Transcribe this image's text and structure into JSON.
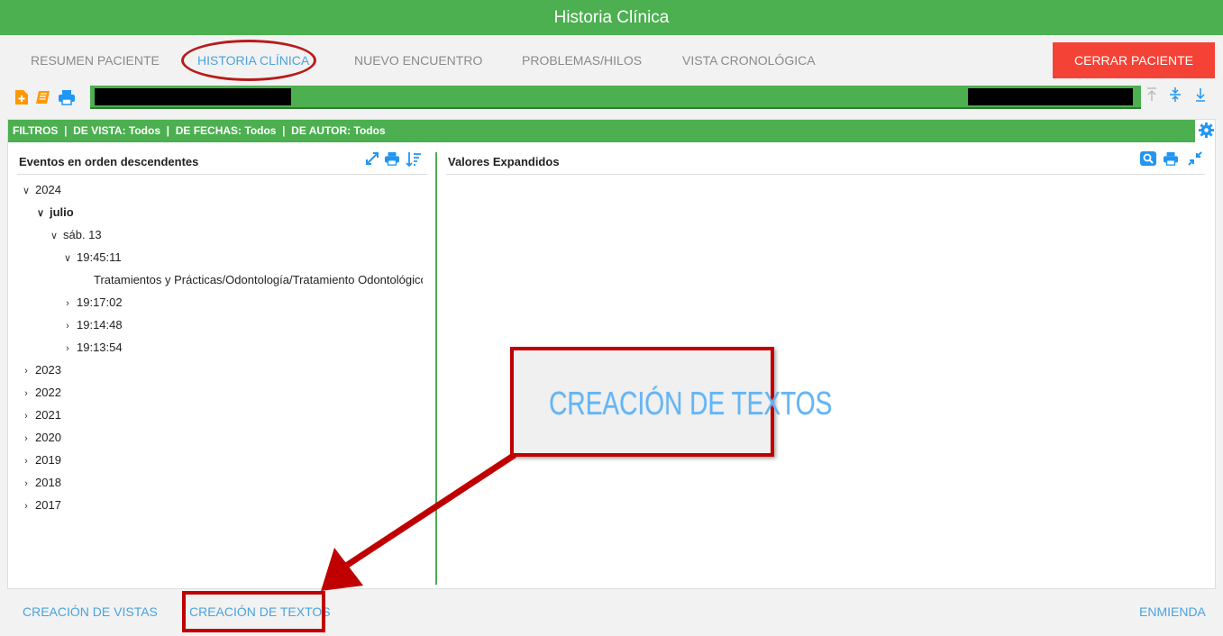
{
  "app": {
    "title": "Historia Clínica"
  },
  "tabs": [
    {
      "label": "RESUMEN PACIENTE"
    },
    {
      "label": "HISTORIA CLÍNICA"
    },
    {
      "label": "NUEVO ENCUENTRO"
    },
    {
      "label": "PROBLEMAS/HILOS"
    },
    {
      "label": "VISTA CRONOLÓGICA"
    }
  ],
  "close_button": {
    "label": "CERRAR PACIENTE",
    "color": "#f44336"
  },
  "toolbar": {
    "icons": [
      "new-document-icon",
      "book-icon",
      "print-icon"
    ],
    "nav_icons": [
      "scroll-top-icon",
      "collapse-icon",
      "scroll-bottom-icon"
    ]
  },
  "filters": {
    "text": "FILTROS  |  DE VISTA: Todos  |  DE FECHAS: Todos  |  DE AUTOR: Todos"
  },
  "left_pane": {
    "title": "Eventos en orden descendentes",
    "tree": [
      {
        "label": "2024"
      },
      {
        "label": "julio"
      },
      {
        "label": "sáb. 13"
      },
      {
        "label": "19:45:11"
      },
      {
        "label": "Tratamientos y Prácticas/Odontología/Tratamiento Odontológico"
      },
      {
        "label": "19:17:02"
      },
      {
        "label": "19:14:48"
      },
      {
        "label": "19:13:54"
      },
      {
        "label": "2023"
      },
      {
        "label": "2022"
      },
      {
        "label": "2021"
      },
      {
        "label": "2020"
      },
      {
        "label": "2019"
      },
      {
        "label": "2018"
      },
      {
        "label": "2017"
      }
    ]
  },
  "right_pane": {
    "title": "Valores Expandidos"
  },
  "callout": {
    "text": "CREACIÓN DE TEXTOS",
    "border_color": "#c00000"
  },
  "footer": {
    "left_link": "CREACIÓN DE VISTAS",
    "middle_link": "CREACIÓN DE TEXTOS",
    "right_link": "ENMIENDA"
  },
  "colors": {
    "green": "#4caf50",
    "blue": "#2196f3",
    "link": "#4aa3df",
    "highlight": "#c00000"
  }
}
